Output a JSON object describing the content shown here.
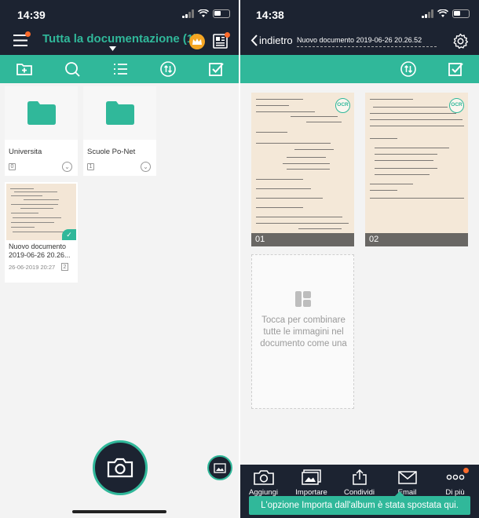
{
  "colors": {
    "accent": "#30b89a",
    "dark": "#1c2331",
    "notification": "#ff6b2b",
    "background": "#f3f3f3"
  },
  "left": {
    "status": {
      "time": "14:39"
    },
    "header": {
      "title": "Tutta la documentazione (1)",
      "icons": [
        "menu-icon",
        "crown-icon",
        "newspaper-icon"
      ]
    },
    "toolbar": [
      "add-folder-icon",
      "search-icon",
      "list-view-icon",
      "sort-icon",
      "select-icon"
    ],
    "folders": [
      {
        "name": "Universita",
        "count": "0"
      },
      {
        "name": "Scuole Po-Net",
        "count": "1"
      }
    ],
    "document": {
      "name": "Nuovo documento 2019-06-26 20.26...",
      "date": "26-06-2019 20:27",
      "pages": "2"
    }
  },
  "right": {
    "status": {
      "time": "14:38"
    },
    "header": {
      "back_label": "indietro",
      "doc_title": "Nuovo documento 2019-06-26 20.26.52"
    },
    "toolbar": [
      "sort-icon",
      "select-icon"
    ],
    "pages": [
      {
        "label": "01",
        "ocr": "OCR"
      },
      {
        "label": "02",
        "ocr": "OCR"
      }
    ],
    "combine_text": "Tocca per combinare tutte le immagini nel documento come una",
    "bottom_bar": [
      {
        "label": "Aggiungi",
        "icon": "camera-icon"
      },
      {
        "label": "Importare",
        "icon": "gallery-icon"
      },
      {
        "label": "Condividi",
        "icon": "share-icon"
      },
      {
        "label": "Email",
        "icon": "email-icon"
      },
      {
        "label": "Di più",
        "icon": "more-icon"
      }
    ],
    "toast": "L'opzione Importa dall'album è stata spostata qui."
  }
}
